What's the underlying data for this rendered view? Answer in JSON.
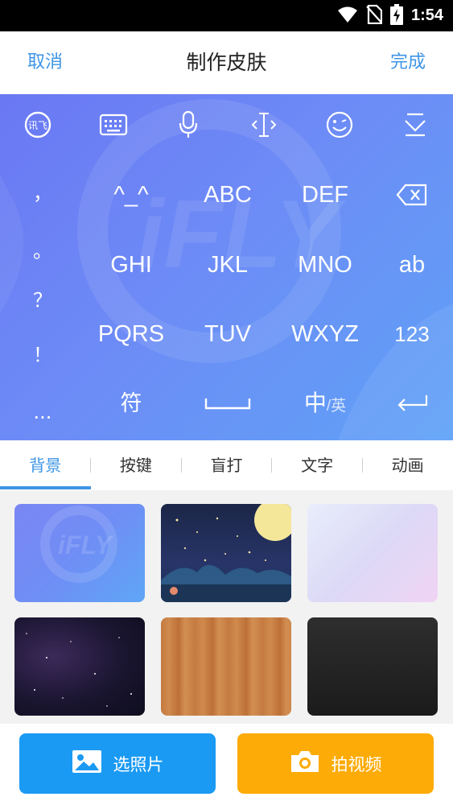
{
  "status_bar": {
    "time": "1:54",
    "icons": [
      "wifi-icon",
      "no-sim-icon",
      "battery-charging-icon"
    ]
  },
  "header": {
    "cancel": "取消",
    "title": "制作皮肤",
    "done": "完成"
  },
  "keyboard": {
    "toolbar_icons": [
      "ifly-logo-icon",
      "keyboard-icon",
      "microphone-icon",
      "cursor-icon",
      "emoji-icon",
      "hide-keyboard-icon"
    ],
    "punctuation": [
      "，",
      "。",
      "？",
      "！",
      "..."
    ],
    "rows": [
      [
        "^_^",
        "ABC",
        "DEF"
      ],
      [
        "GHI",
        "JKL",
        "MNO",
        "ab"
      ],
      [
        "PQRS",
        "TUV",
        "WXYZ",
        "123"
      ]
    ],
    "bottom_row": {
      "symbols": "符",
      "lang_main": "中",
      "lang_sep": "/",
      "lang_sub": "英"
    },
    "right_icons": [
      "backspace-icon",
      "enter-icon"
    ],
    "watermark": "iFLY"
  },
  "tabs": [
    {
      "label": "背景",
      "active": true
    },
    {
      "label": "按键",
      "active": false
    },
    {
      "label": "盲打",
      "active": false
    },
    {
      "label": "文字",
      "active": false
    },
    {
      "label": "动画",
      "active": false
    }
  ],
  "thumbnails": {
    "first_watermark": "iFLY",
    "items": [
      "default-blue",
      "night-moon",
      "pastel-gradient",
      "galaxy",
      "wood",
      "dark-metal"
    ]
  },
  "bottom_buttons": {
    "photo": "选照片",
    "video": "拍视频"
  },
  "colors": {
    "accent": "#3e95e6",
    "photo_button": "#1a9af3",
    "video_button": "#fdab06"
  }
}
